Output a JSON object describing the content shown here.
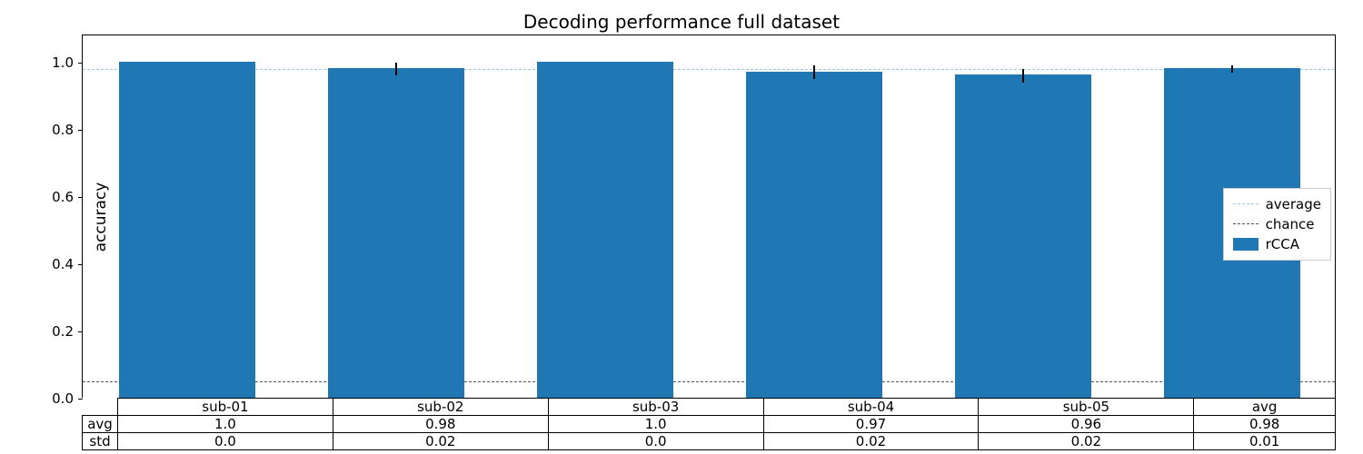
{
  "chart_data": {
    "type": "bar",
    "title": "Decoding performance full dataset",
    "xlabel": "",
    "ylabel": "accuracy",
    "ylim": [
      0,
      1.08
    ],
    "yticks": [
      0.0,
      0.2,
      0.4,
      0.6,
      0.8,
      1.0
    ],
    "categories": [
      "sub-01",
      "sub-02",
      "sub-03",
      "sub-04",
      "sub-05",
      "avg"
    ],
    "series": [
      {
        "name": "rCCA",
        "values": [
          1.0,
          0.98,
          1.0,
          0.97,
          0.96,
          0.98
        ],
        "err": [
          0.0,
          0.02,
          0.0,
          0.02,
          0.02,
          0.01
        ],
        "color": "#1f77b4"
      }
    ],
    "reference_lines": {
      "average": 0.98,
      "chance": 0.05
    },
    "table": {
      "row_headers": [
        "avg",
        "std"
      ],
      "rows": [
        [
          "1.0",
          "0.98",
          "1.0",
          "0.97",
          "0.96",
          "0.98"
        ],
        [
          "0.0",
          "0.02",
          "0.0",
          "0.02",
          "0.02",
          "0.01"
        ]
      ]
    },
    "legend": [
      {
        "label": "average",
        "kind": "line",
        "style": "dashed",
        "color": "#9ecae1"
      },
      {
        "label": "chance",
        "kind": "line",
        "style": "dashed",
        "color": "#555555"
      },
      {
        "label": "rCCA",
        "kind": "patch",
        "color": "#1f77b4"
      }
    ]
  },
  "ytick_labels": [
    "0.0",
    "0.2",
    "0.4",
    "0.6",
    "0.8",
    "1.0"
  ]
}
